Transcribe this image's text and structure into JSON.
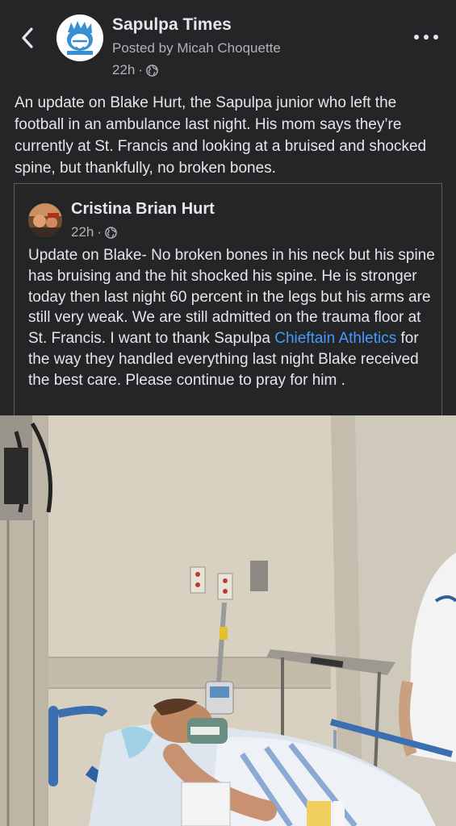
{
  "header": {
    "page_name": "Sapulpa Times",
    "posted_by": "Posted by Micah Choquette",
    "time": "22h",
    "dot": "·",
    "back_icon": "chevron-left-icon",
    "more_icon": "more-horizontal-icon",
    "audience_icon": "globe-icon"
  },
  "post": {
    "text": "An update on Blake Hurt, the Sapulpa junior who left the football in an ambulance last night. His mom says they’re currently at St. Francis and looking at a bruised and shocked spine, but thankfully, no broken bones."
  },
  "shared_post": {
    "author": "Cristina Brian Hurt",
    "time": "22h",
    "dot": "·",
    "text_before_link": "Update on Blake- No broken bones in his neck but his spine has bruising and the hit shocked his spine. He is stronger today then last night 60 percent in the legs but his arms are still very  weak. We are still admitted on the trauma floor at St. Francis. I want to thank Sapulpa ",
    "link_text": "Chieftain Athletics",
    "text_after_link": " for the way they handled everything last night Blake received the best care. Please continue to pray for him ."
  },
  "colors": {
    "background": "#242526",
    "text_primary": "#e4e6eb",
    "text_secondary": "#b0b3b8",
    "link": "#4599ff",
    "border": "#5a5c60"
  }
}
